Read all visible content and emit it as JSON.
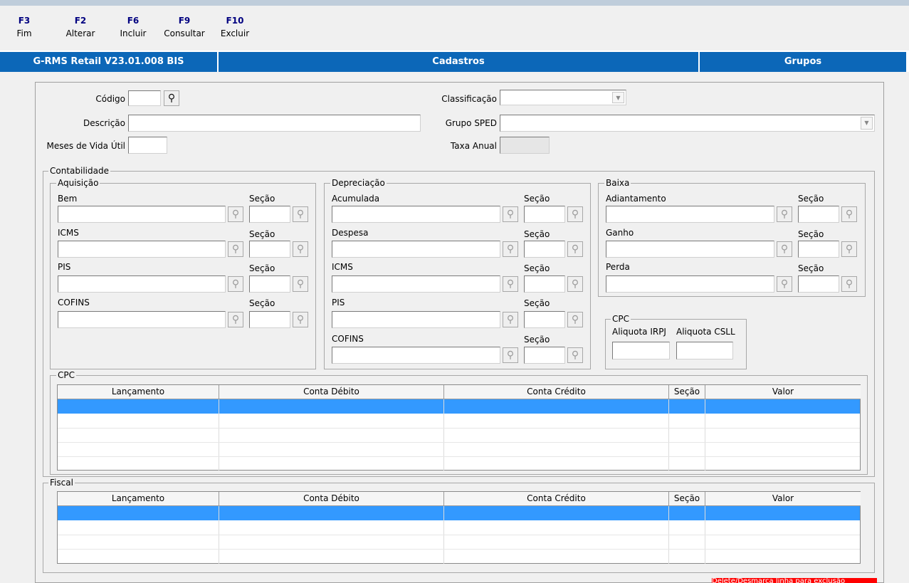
{
  "toolbar": {
    "keys": [
      {
        "key": "F3",
        "label": "Fim"
      },
      {
        "key": "F2",
        "label": "Alterar"
      },
      {
        "key": "F6",
        "label": "Incluir"
      },
      {
        "key": "F9",
        "label": "Consultar"
      },
      {
        "key": "F10",
        "label": "Excluir"
      }
    ]
  },
  "header": {
    "app": "G-RMS Retail V23.01.008 BIS",
    "module": "Cadastros",
    "screen": "Grupos"
  },
  "form": {
    "codigo_label": "Código",
    "codigo_value": "",
    "descricao_label": "Descrição",
    "descricao_value": "",
    "meses_label": "Meses de Vida Útil",
    "meses_value": "",
    "classificacao_label": "Classificação",
    "classificacao_value": "",
    "grupo_sped_label": "Grupo SPED",
    "grupo_sped_value": "",
    "taxa_label": "Taxa Anual",
    "taxa_value": ""
  },
  "contabilidade": {
    "title": "Contabilidade",
    "secao_label": "Seção",
    "aquisicao": {
      "title": "Aquisição",
      "fields": [
        "Bem",
        "ICMS",
        "PIS",
        "COFINS"
      ]
    },
    "depreciacao": {
      "title": "Depreciação",
      "fields": [
        "Acumulada",
        "Despesa",
        "ICMS",
        "PIS",
        "COFINS"
      ]
    },
    "baixa": {
      "title": "Baixa",
      "fields": [
        "Adiantamento",
        "Ganho",
        "Perda"
      ]
    },
    "cpc_box": {
      "title": "CPC",
      "irpj_label": "Aliquota IRPJ",
      "csll_label": "Aliquota CSLL",
      "irpj_value": "",
      "csll_value": ""
    }
  },
  "cpc_grid": {
    "title": "CPC",
    "columns": [
      "Lançamento",
      "Conta Débito",
      "Conta  Crédito",
      "Seção",
      "Valor"
    ]
  },
  "fiscal_grid": {
    "title": "Fiscal",
    "columns": [
      "Lançamento",
      "Conta Débito",
      "Conta  Crédito",
      "Seção",
      "Valor"
    ]
  },
  "status": {
    "text": "Delete/Desmarca linha para exclusão"
  },
  "colors": {
    "header_blue": "#0c67b8",
    "selection_blue": "#3399ff",
    "fkey_navy": "#000080",
    "status_red": "#ff0000"
  },
  "icons": {
    "lookup": "binoculars-icon",
    "dropdown": "chevron-down-icon"
  }
}
